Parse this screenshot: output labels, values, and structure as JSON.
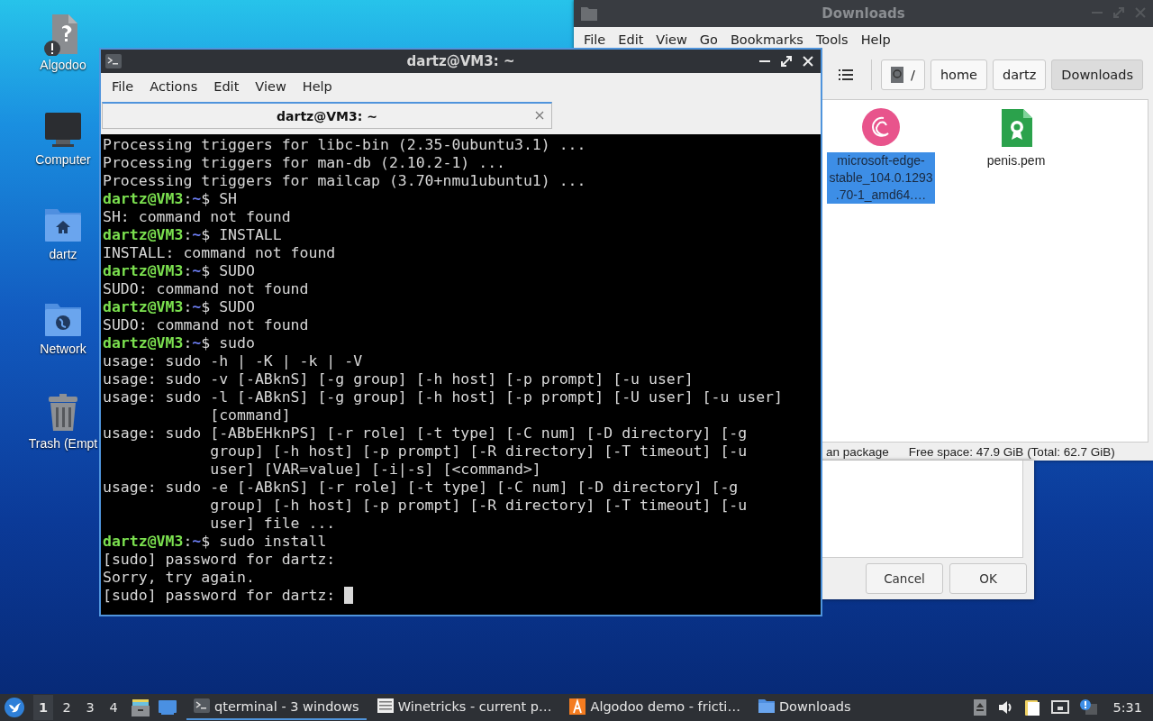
{
  "desktop_icons": [
    {
      "label": "Algodoo",
      "kind": "unknown-file"
    },
    {
      "label": "Computer",
      "kind": "computer"
    },
    {
      "label": "dartz",
      "kind": "home"
    },
    {
      "label": "Network",
      "kind": "network"
    },
    {
      "label": "Trash (Empt",
      "kind": "trash"
    }
  ],
  "file_manager": {
    "title": "Downloads",
    "menu": [
      "File",
      "Edit",
      "View",
      "Go",
      "Bookmarks",
      "Tools",
      "Help"
    ],
    "breadcrumbs": [
      {
        "label": "/",
        "kind": "root",
        "selected": false
      },
      {
        "label": "home",
        "kind": "folder",
        "selected": false
      },
      {
        "label": "dartz",
        "kind": "folder",
        "selected": false
      },
      {
        "label": "Downloads",
        "kind": "folder",
        "selected": true
      }
    ],
    "files": [
      {
        "name": "microsoft-edge-stable_104.0.1293.70-1_amd64.…",
        "kind": "deb",
        "selected": true
      },
      {
        "name": "penis.pem",
        "kind": "certificate",
        "selected": false
      }
    ],
    "status": "an package",
    "free_space": "Free space: 47.9 GiB (Total: 62.7 GiB)"
  },
  "dialog": {
    "buttons": [
      "Cancel",
      "OK"
    ]
  },
  "terminal": {
    "title": "dartz@VM3: ~",
    "menu": [
      "File",
      "Actions",
      "Edit",
      "View",
      "Help"
    ],
    "tabs": [
      {
        "label": "dartz@VM3: ~",
        "selected": true
      }
    ],
    "lines": [
      {
        "kind": "output",
        "text": "Processing triggers for libc-bin (2.35-0ubuntu3.1) ..."
      },
      {
        "kind": "output",
        "text": "Processing triggers for man-db (2.10.2-1) ..."
      },
      {
        "kind": "output",
        "text": "Processing triggers for mailcap (3.70+nmu1ubuntu1) ..."
      },
      {
        "kind": "prompt",
        "host": "dartz@VM3",
        "separator": ":",
        "path": "~",
        "command": "$ SH"
      },
      {
        "kind": "output",
        "text": "SH: command not found"
      },
      {
        "kind": "prompt",
        "host": "dartz@VM3",
        "separator": ":",
        "path": "~",
        "command": "$ INSTALL"
      },
      {
        "kind": "output",
        "text": "INSTALL: command not found"
      },
      {
        "kind": "prompt",
        "host": "dartz@VM3",
        "separator": ":",
        "path": "~",
        "command": "$ SUDO"
      },
      {
        "kind": "output",
        "text": "SUDO: command not found"
      },
      {
        "kind": "prompt",
        "host": "dartz@VM3",
        "separator": ":",
        "path": "~",
        "command": "$ SUDO"
      },
      {
        "kind": "output",
        "text": "SUDO: command not found"
      },
      {
        "kind": "prompt",
        "host": "dartz@VM3",
        "separator": ":",
        "path": "~",
        "command": "$ sudo"
      },
      {
        "kind": "output",
        "text": "usage: sudo -h | -K | -k | -V"
      },
      {
        "kind": "output",
        "text": "usage: sudo -v [-ABknS] [-g group] [-h host] [-p prompt] [-u user]"
      },
      {
        "kind": "output",
        "text": "usage: sudo -l [-ABknS] [-g group] [-h host] [-p prompt] [-U user] [-u user]"
      },
      {
        "kind": "output",
        "text": "            [command]"
      },
      {
        "kind": "output",
        "text": "usage: sudo [-ABbEHknPS] [-r role] [-t type] [-C num] [-D directory] [-g"
      },
      {
        "kind": "output",
        "text": "            group] [-h host] [-p prompt] [-R directory] [-T timeout] [-u"
      },
      {
        "kind": "output",
        "text": "            user] [VAR=value] [-i|-s] [<command>]"
      },
      {
        "kind": "output",
        "text": "usage: sudo -e [-ABknS] [-r role] [-t type] [-C num] [-D directory] [-g"
      },
      {
        "kind": "output",
        "text": "            group] [-h host] [-p prompt] [-R directory] [-T timeout] [-u"
      },
      {
        "kind": "output",
        "text": "            user] file ..."
      },
      {
        "kind": "prompt",
        "host": "dartz@VM3",
        "separator": ":",
        "path": "~",
        "command": "$ sudo install"
      },
      {
        "kind": "output",
        "text": "[sudo] password for dartz:"
      },
      {
        "kind": "output",
        "text": "Sorry, try again."
      },
      {
        "kind": "output",
        "text": "[sudo] password for dartz:"
      }
    ],
    "cursor": true
  },
  "taskbar": {
    "workspaces": [
      {
        "label": "1",
        "selected": true
      },
      {
        "label": "2",
        "selected": false
      },
      {
        "label": "3",
        "selected": false
      },
      {
        "label": "4",
        "selected": false
      }
    ],
    "tasks": [
      {
        "label": "qterminal - 3 windows",
        "kind": "terminal",
        "selected": true
      },
      {
        "label": "Winetricks - current p…",
        "kind": "list",
        "selected": false
      },
      {
        "label": "Algodoo demo - fricti…",
        "kind": "app",
        "selected": false
      },
      {
        "label": "Downloads",
        "kind": "folder",
        "selected": false
      }
    ],
    "clock": "5:31"
  }
}
